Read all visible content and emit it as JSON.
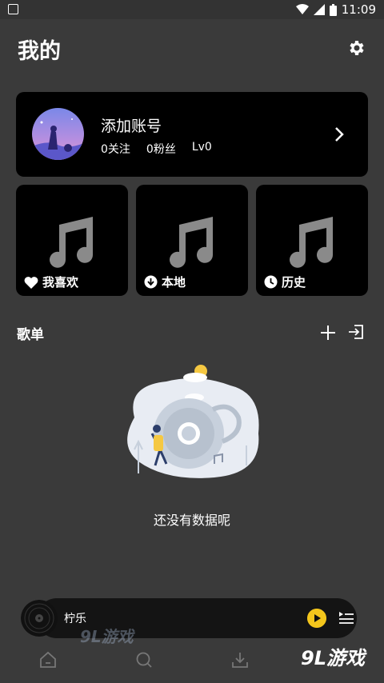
{
  "status_bar": {
    "time": "11:09"
  },
  "header": {
    "title": "我的"
  },
  "account": {
    "name": "添加账号",
    "following": "0关注",
    "followers": "0粉丝",
    "level": "Lv0"
  },
  "quick_cards": [
    {
      "label": "我喜欢",
      "icon": "heart-icon"
    },
    {
      "label": "本地",
      "icon": "download-circle-icon"
    },
    {
      "label": "历史",
      "icon": "clock-icon"
    }
  ],
  "playlists": {
    "title": "歌单",
    "empty_text": "还没有数据呢"
  },
  "player": {
    "title": "柠乐"
  },
  "watermark": {
    "left": "9L游戏",
    "right": "9L游戏"
  },
  "colors": {
    "background": "#3a3a3a",
    "card": "#000000",
    "accent": "#f4c61c"
  }
}
